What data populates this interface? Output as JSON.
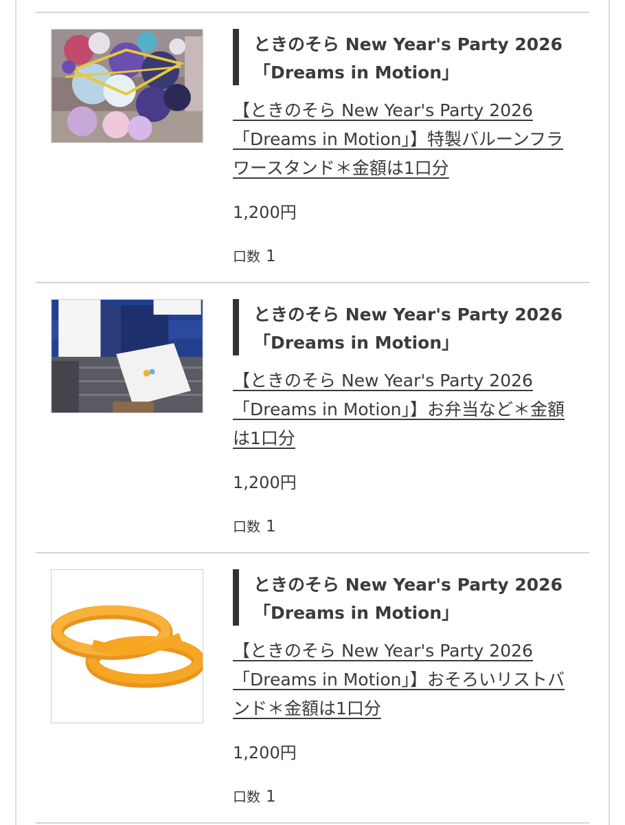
{
  "products": [
    {
      "event_title": "ときのそら New Year's Party 2026\n「Dreams in Motion」",
      "name": "【ときのそら New Year's Party 2026「Dreams in Motion」】特製バルーンフラワースタンド＊金額は1口分",
      "price": "1,200円",
      "quantity_label": "口数",
      "quantity": "1",
      "image": "balloon-flower-stand-photo"
    },
    {
      "event_title": "ときのそら New Year's Party 2026\n「Dreams in Motion」",
      "name": "【ときのそら New Year's Party 2026「Dreams in Motion」】お弁当など＊金額は1口分",
      "price": "1,200円",
      "quantity_label": "口数",
      "quantity": "1",
      "image": "bento-boxes-photo"
    },
    {
      "event_title": "ときのそら New Year's Party 2026\n「Dreams in Motion」",
      "name": "【ときのそら New Year's Party 2026「Dreams in Motion」】おそろいリストバンド＊金額は1口分",
      "price": "1,200円",
      "quantity_label": "口数",
      "quantity": "1",
      "image": "wristband-illustration"
    }
  ],
  "colors": {
    "text": "#3a3a3a",
    "divider": "#d4d4d4",
    "title_bar": "#333333",
    "wristband": "#f6a623"
  }
}
